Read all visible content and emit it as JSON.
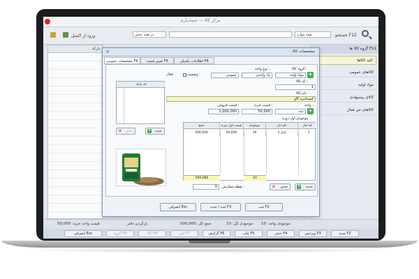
{
  "window": {
    "title": "مرکز کالا — حسابداری"
  },
  "toolbar": {
    "search_label": "جستجو F12",
    "group_label": "همه موارد",
    "branch_value": "در همه بخش",
    "import_label": "ورود از اکسل",
    "group_list_title": "گروه کالا ها F11"
  },
  "right_panel": {
    "header": "گروه کالاها",
    "items": [
      "کلیه کالاها",
      "کالاهای عمومی",
      "مواد اولیه",
      "کالای پیشنهادی",
      "کالاهای غیر فعال"
    ]
  },
  "grid": {
    "col1": "بارکد",
    "col2": "موجودی"
  },
  "footer_info": {
    "total_qty": "موجودی کل: 10",
    "total_value": "موجودی واحد: 10",
    "stock_label": "بازکردن دفتر",
    "cost_label": "جمع کل: 500,000",
    "price_label": "قیمت واحد خرید: 50,000"
  },
  "bottom_bar": {
    "buttons": [
      "جدید F2",
      "ویرایش F3",
      "حذف F4",
      "چاپ F5",
      "گزارش F6",
      "کپی F7",
      "کالا F8",
      "گروه F9",
      "انصراف Esc"
    ]
  },
  "dialog": {
    "title": "مشخصات کالا",
    "tabs": [
      "مشخصات عمومی F6",
      "تعیین قیمت F5",
      "اطلاعات تکمیلی F4"
    ],
    "form": {
      "group_label": "گروه کالا :",
      "group_value": "مواد اولیه",
      "type_label": "نوع واحد :",
      "type_value": "یک واحدی",
      "category_value": "عمومی",
      "status_label": "وضعیت :",
      "status_check": "فعال",
      "code_label": "کد کالا :",
      "code_value": "1",
      "name_label": "نام کالا :",
      "name_value": "کنستانتره گاو",
      "unit_label": "واحد :",
      "unit_value": "عدد",
      "buy_label": "قیمت خرید :",
      "buy_value": "50,000",
      "sell_label": "قیمت فروش :",
      "sell_value": "1,000,000",
      "initial_label": "موجودی اول دوره",
      "barcode_header": "کد بارکد",
      "new_label": "جدید",
      "cancel_label": "حذف",
      "reorder_label": "نقطه سفارش :",
      "reorder_value": "0"
    },
    "table": {
      "headers": [
        "کد انبار",
        "نام انبار",
        "موجودی",
        "قیمت اول دوره",
        "جمع"
      ],
      "rows": [
        {
          "code": "1",
          "name": "انبار 1",
          "qty": "10",
          "price": "50,000",
          "total": "500,000"
        }
      ],
      "sum_total": "500,000",
      "sum_qty": "10"
    },
    "footer": {
      "save": "ثبت F2",
      "save_new": "ثبت / جدید F3",
      "cancel": "انصراف Esc"
    }
  }
}
